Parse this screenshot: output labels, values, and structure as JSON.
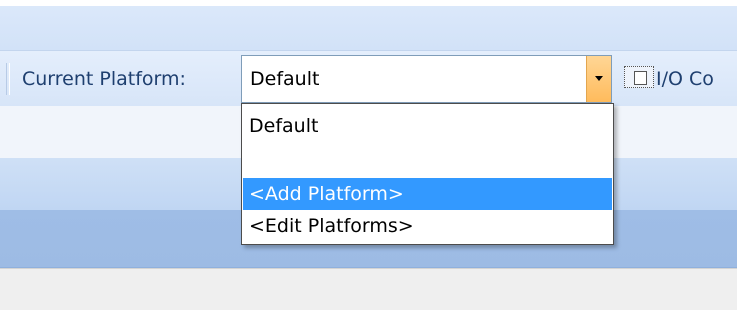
{
  "toolbar": {
    "current_platform_label": "Current Platform:",
    "platform_value": "Default",
    "io_label": "I/O Co"
  },
  "dropdown": {
    "options": [
      {
        "label": "Default",
        "selected": false
      },
      {
        "label": "",
        "selected": false
      },
      {
        "label": "<Add Platform>",
        "selected": true
      },
      {
        "label": "<Edit Platforms>",
        "selected": false
      }
    ]
  },
  "colors": {
    "selection": "#3399ff",
    "arrow_button": "#ffbb5c",
    "toolbar_text": "#1e3f6f"
  },
  "icons": {
    "dropdown_arrow": "chevron-down-icon",
    "io_config": "io-config-icon"
  }
}
